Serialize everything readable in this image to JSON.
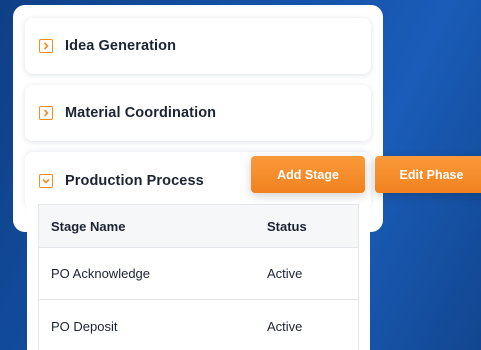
{
  "accordion": {
    "items": [
      {
        "label": "Idea Generation",
        "expanded": false,
        "icon": "chevron-right-icon"
      },
      {
        "label": "Material Coordination",
        "expanded": false,
        "icon": "chevron-right-icon"
      },
      {
        "label": "Production Process",
        "expanded": true,
        "icon": "chevron-down-icon"
      }
    ]
  },
  "actions": {
    "add_stage_label": "Add Stage",
    "edit_phase_label": "Edit Phase"
  },
  "table": {
    "headers": {
      "name": "Stage Name",
      "status": "Status"
    },
    "rows": [
      {
        "name": "PO Acknowledge",
        "status": "Active"
      },
      {
        "name": "PO Deposit",
        "status": "Active"
      }
    ]
  },
  "colors": {
    "accent": "#f58a1f",
    "background": "#1452a8",
    "text": "#1c2433"
  }
}
